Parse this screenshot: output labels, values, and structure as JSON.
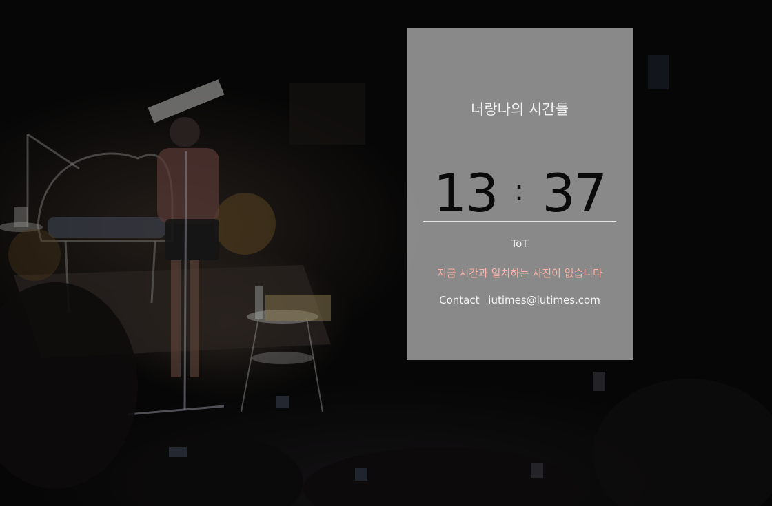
{
  "card": {
    "title": "너랑나의 시간들",
    "clock": {
      "hours": "13",
      "separator": ":",
      "minutes": "37"
    },
    "status": "ToT",
    "message": "지금 시간과 일치하는 사진이 없습니다",
    "contact_label": "Contact",
    "contact_email": "iutimes@iutimes.com"
  },
  "colors": {
    "card_background": "#a0a0a0",
    "message_text": "#ffb3a8",
    "clock_text": "#0a0a0a",
    "page_background": "#060606"
  }
}
